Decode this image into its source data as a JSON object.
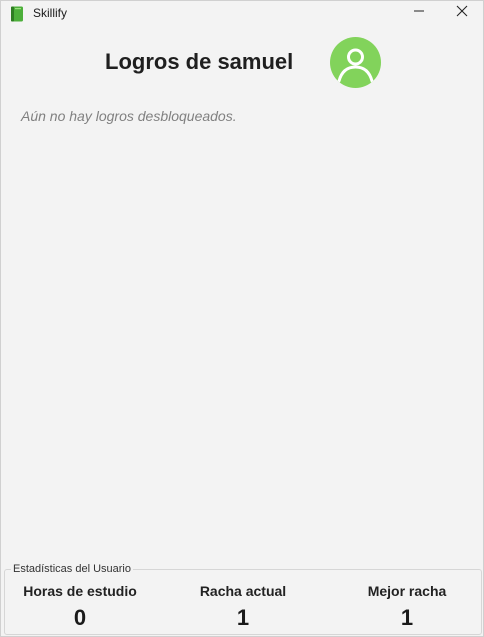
{
  "window": {
    "title": "Skillify",
    "icon": "green-book-icon",
    "controls": {
      "minimize": "minimize-icon",
      "close": "close-icon"
    }
  },
  "header": {
    "title": "Logros de samuel",
    "avatar_icon": "user-avatar-icon",
    "avatar_color": "#82d35b"
  },
  "achievements": {
    "empty_message": "Aún no hay logros desbloqueados."
  },
  "stats": {
    "legend": "Estadísticas del Usuario",
    "items": [
      {
        "label": "Horas de estudio",
        "value": "0"
      },
      {
        "label": "Racha actual",
        "value": "1"
      },
      {
        "label": "Mejor racha",
        "value": "1"
      }
    ]
  }
}
